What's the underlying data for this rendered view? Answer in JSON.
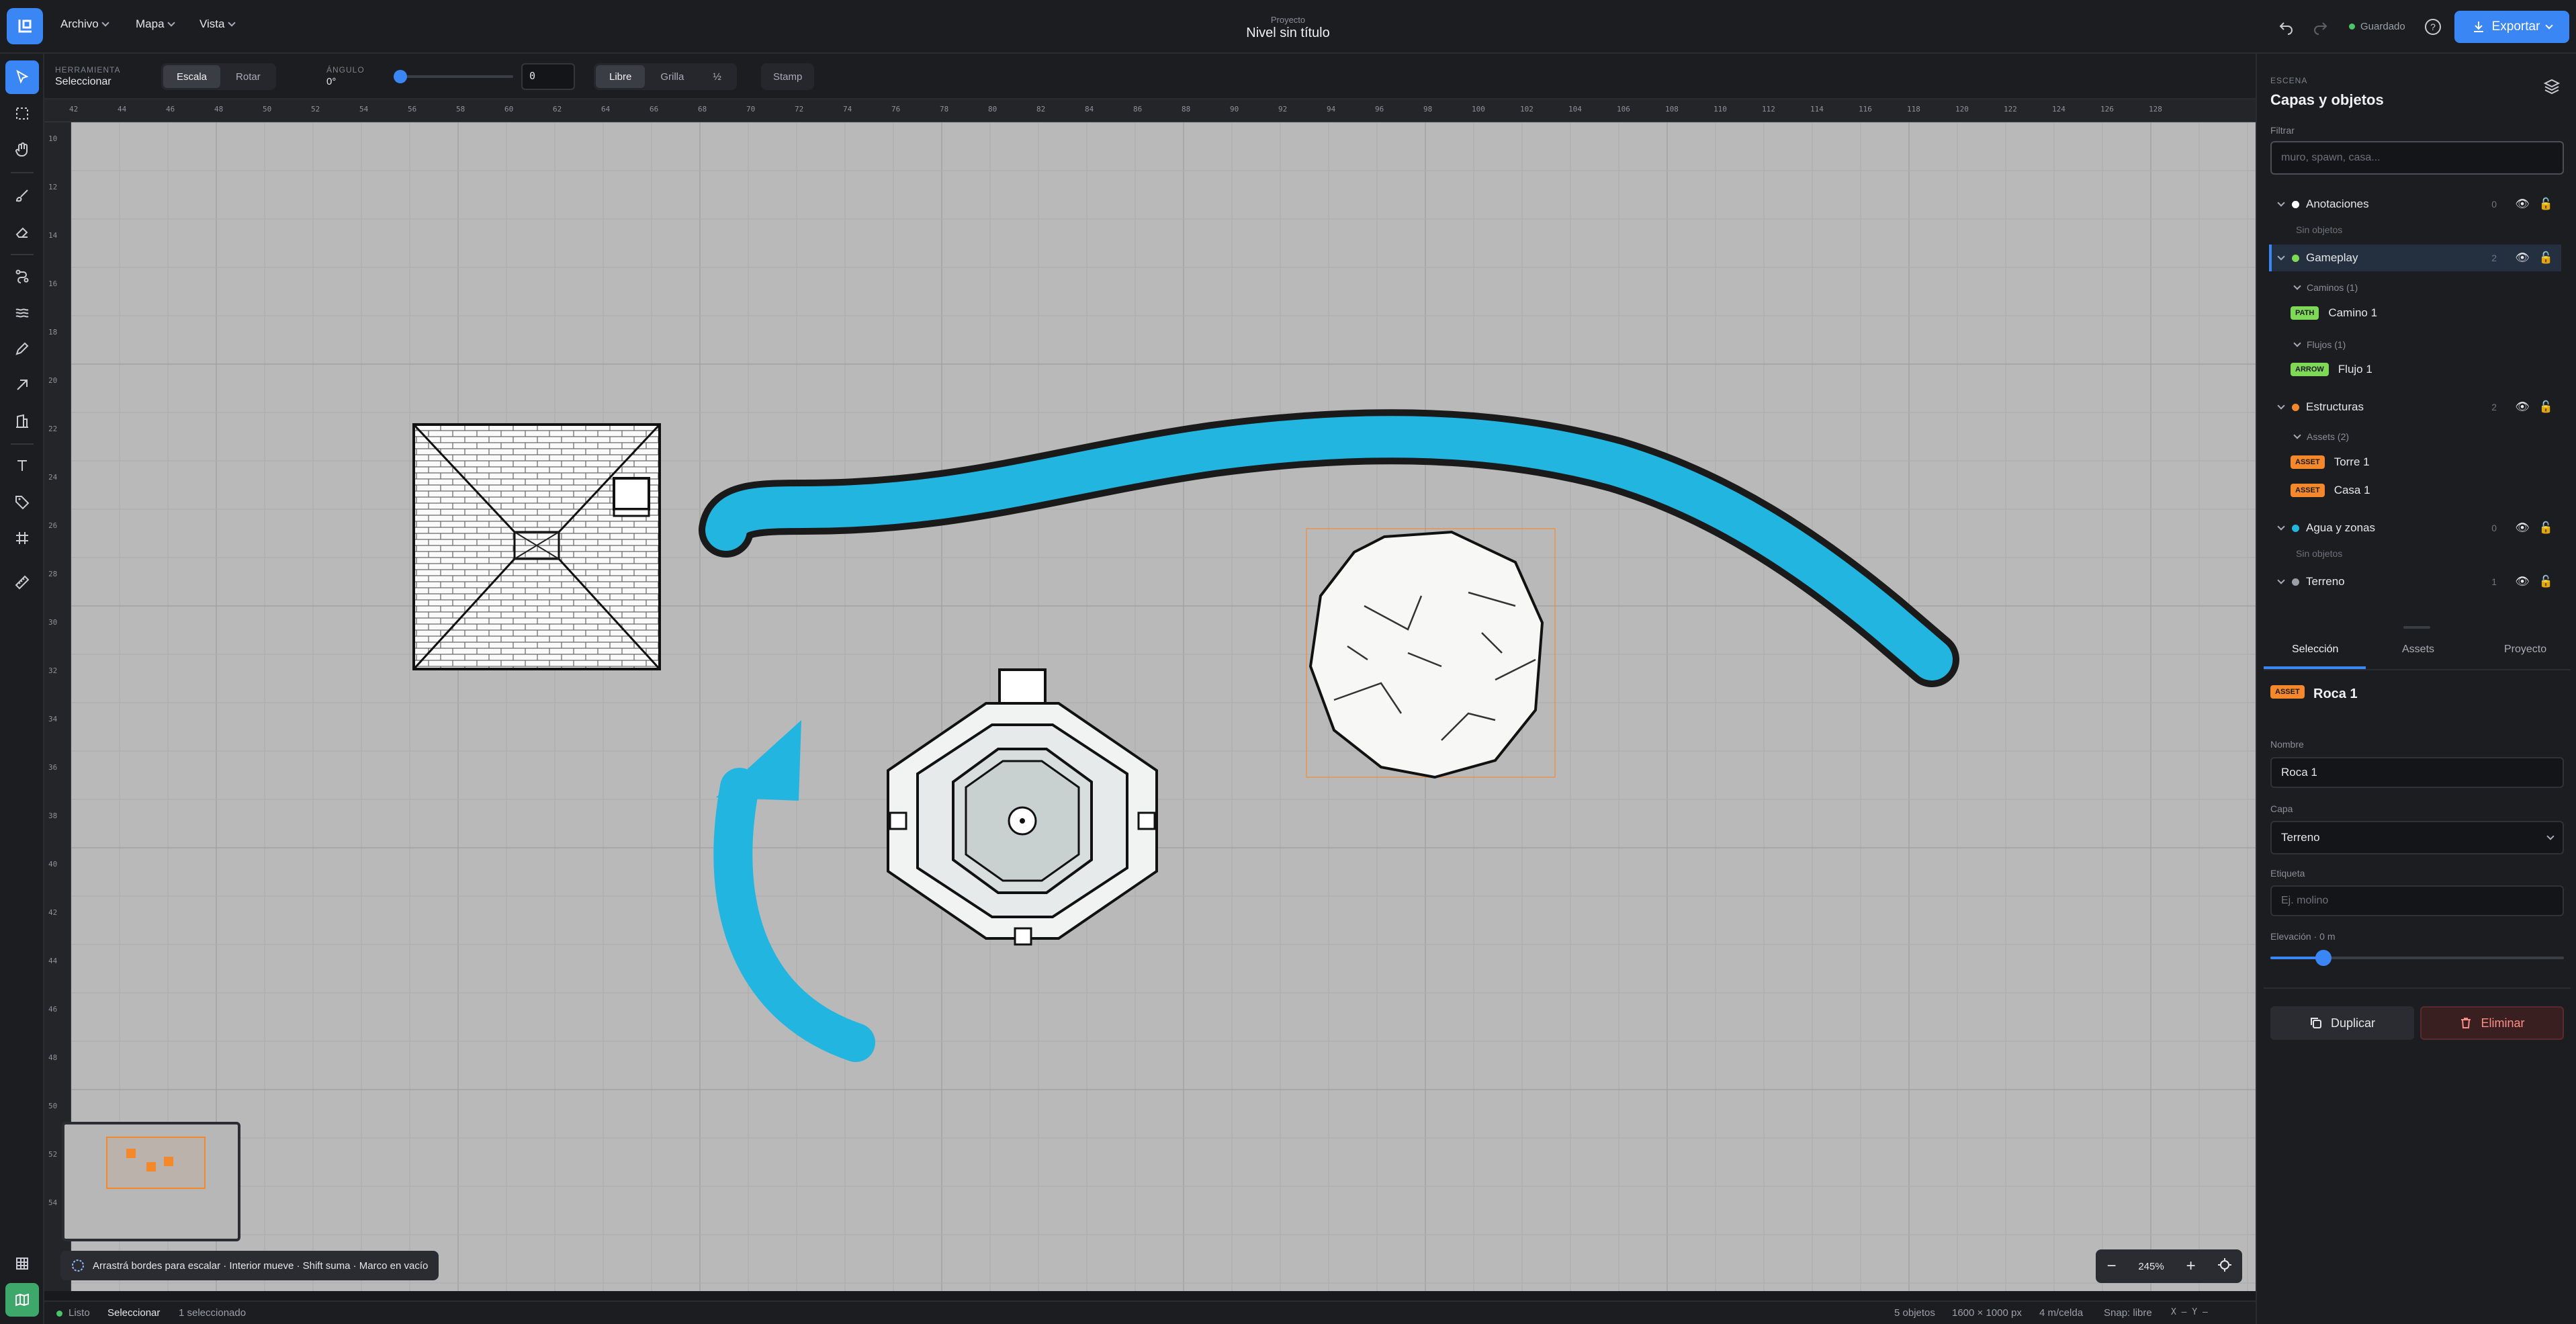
{
  "menus": [
    "Archivo",
    "Mapa",
    "Vista"
  ],
  "project": {
    "kicker": "Proyecto",
    "title": "Nivel sin título"
  },
  "saved": "Guardado",
  "export_label": "Exportar",
  "tool": {
    "kicker": "HERRAMIENTA",
    "value": "Seleccionar"
  },
  "mode_seg": [
    "Escala",
    "Rotar"
  ],
  "angle": {
    "kicker": "ÁNGULO",
    "value": "0°",
    "input": "0",
    "slider_fraction": 0
  },
  "snap_seg": [
    "Libre",
    "Grilla",
    "½"
  ],
  "stamp": "Stamp",
  "ruler_h": [
    "42",
    "44",
    "46",
    "48",
    "50",
    "52",
    "54",
    "56",
    "58",
    "60",
    "62",
    "64",
    "66",
    "68",
    "70",
    "72",
    "74",
    "76",
    "78",
    "80",
    "82",
    "84",
    "86",
    "88",
    "90",
    "92",
    "94",
    "96",
    "98",
    "100",
    "102",
    "104",
    "106",
    "108",
    "110",
    "112",
    "114",
    "116",
    "118",
    "120",
    "122",
    "124",
    "126",
    "128"
  ],
  "ruler_v": [
    "10",
    "12",
    "14",
    "16",
    "18",
    "20",
    "22",
    "24",
    "26",
    "28",
    "30",
    "32",
    "34",
    "36",
    "38",
    "40",
    "42",
    "44",
    "46",
    "48",
    "50",
    "52",
    "54"
  ],
  "panel": {
    "kicker": "ESCENA",
    "title": "Capas y objetos",
    "filter_label": "Filtrar",
    "filter_placeholder": "muro, spawn, casa...",
    "layers": [
      {
        "name": "Anotaciones",
        "count": "0",
        "color": "#ffffff"
      },
      {
        "name": "Gameplay",
        "count": "2",
        "color": "#7ed957"
      },
      {
        "name": "Estructuras",
        "count": "2",
        "color": "#f5882a"
      },
      {
        "name": "Agua y zonas",
        "count": "0",
        "color": "#22b5e0"
      },
      {
        "name": "Terreno",
        "count": "1",
        "color": "#9a9ea6"
      }
    ],
    "empty": "Sin objetos",
    "groups": {
      "caminos": "Caminos (1)",
      "flujos": "Flujos (1)",
      "assets": "Assets (2)"
    },
    "objects": {
      "camino": {
        "chip": "PATH",
        "name": "Camino 1"
      },
      "flujo": {
        "chip": "ARROW",
        "name": "Flujo 1"
      },
      "torre": {
        "chip": "ASSET",
        "name": "Torre 1"
      },
      "casa": {
        "chip": "ASSET",
        "name": "Casa 1"
      }
    },
    "tabs": [
      "Selección",
      "Assets",
      "Proyecto"
    ],
    "selected": {
      "chip": "ASSET",
      "name": "Roca 1"
    },
    "fields": {
      "name_label": "Nombre",
      "name_value": "Roca 1",
      "layer_label": "Capa",
      "layer_value": "Terreno",
      "tag_label": "Etiqueta",
      "tag_placeholder": "Ej. molino",
      "elev_label": "Elevación · 0 m",
      "elev_fraction": 0.18
    },
    "duplicate": "Duplicar",
    "delete": "Eliminar"
  },
  "hint": "Arrastrá bordes para escalar · Interior mueve · Shift suma · Marco en vacío",
  "zoom": "245%",
  "status": {
    "ready": "Listo",
    "tool": "Seleccionar",
    "selection": "1 seleccionado",
    "objects": "5 objetos",
    "size": "1600 × 1000 px",
    "scale": "4 m/celda",
    "snap": "Snap: libre",
    "coords": "X — Y —"
  },
  "colors": {
    "accent": "#3a86f5",
    "water": "#22b5e0",
    "delete": "#e0524d"
  }
}
